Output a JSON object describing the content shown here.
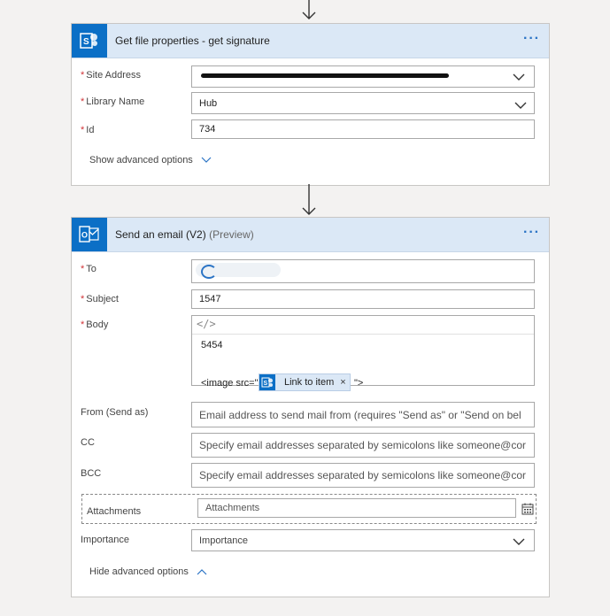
{
  "card1": {
    "title": "Get file properties - get signature",
    "more_label": "···",
    "fields": [
      {
        "label": "Site Address",
        "value": ""
      },
      {
        "label": "Library Name",
        "value": "Hub"
      },
      {
        "label": "Id",
        "value": "734"
      }
    ],
    "advanced_label": "Show advanced options"
  },
  "card2": {
    "title": "Send an email (V2)",
    "subtitle": "(Preview)",
    "more_label": "···",
    "to_label": "To",
    "subject_label": "Subject",
    "subject_value": "1547",
    "body_label": "Body",
    "body_code_icon": "</>",
    "body_line1": "5454",
    "body_line2_prefix": "<image src=\"",
    "body_line2_suffix": "\">",
    "token_label": "Link to item",
    "token_remove": "×",
    "from_label": "From (Send as)",
    "from_placeholder": "Email address to send mail from (requires \"Send as\" or \"Send on bel",
    "cc_label": "CC",
    "cc_placeholder": "Specify email addresses separated by semicolons like someone@cor",
    "bcc_label": "BCC",
    "bcc_placeholder": "Specify email addresses separated by semicolons like someone@cor",
    "attachments_label": "Attachments",
    "attachments_placeholder": "Attachments",
    "importance_label": "Importance",
    "importance_placeholder": "Importance",
    "advanced_label": "Hide advanced options"
  },
  "required_marker": "*",
  "colors": {
    "accent": "#2b74c5",
    "header_bg": "#dbe8f6",
    "required": "#d13438",
    "connector_logo": "#0b6fc6"
  },
  "icons": [
    "arrow-down-icon",
    "sharepoint-icon",
    "outlook-icon",
    "chevron-down-icon",
    "chevron-up-icon",
    "more-icon",
    "code-view-icon",
    "calendar-icon"
  ]
}
